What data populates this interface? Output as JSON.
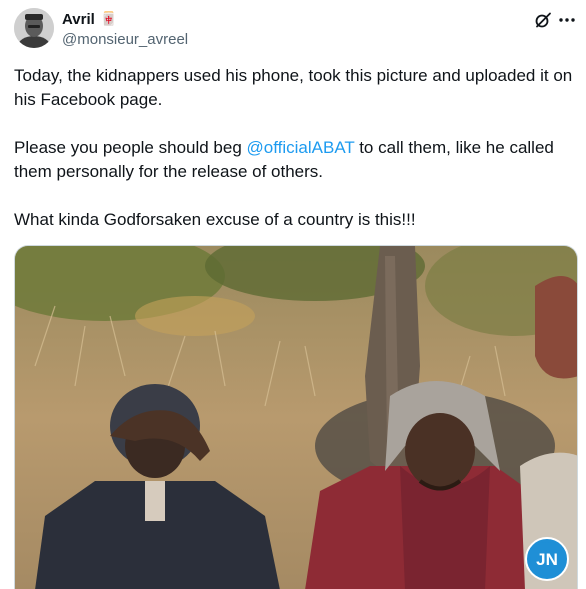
{
  "author": {
    "display_name": "Avril",
    "name_emoji": "🀄",
    "handle": "@monsieur_avreel",
    "avatar_icon": "profile-photo"
  },
  "actions": {
    "grok_icon": "grok-icon",
    "more_icon": "more-icon"
  },
  "tweet": {
    "p1": "Today, the kidnappers used his phone, took this picture and uploaded it on his Facebook page.",
    "p2_before": "Please you people should beg ",
    "p2_mention": "@officialABAT",
    "p2_after": " to call them, like he called them personally for the release of others.",
    "p3": "What kinda Godforsaken excuse of a country is this!!!"
  },
  "media": {
    "watermark_text": "JN",
    "colors": {
      "grass": "#b89a6e",
      "foliage": "#6f7a3a",
      "trunk": "#6b5d4f",
      "jacket_left": "#2b2f3a",
      "jacket_right": "#8e2b35",
      "hood_right": "#a9a39c"
    }
  },
  "colors": {
    "text": "#0f1419",
    "secondary": "#536471",
    "link": "#1d9bf0",
    "border": "#cfd9de"
  }
}
